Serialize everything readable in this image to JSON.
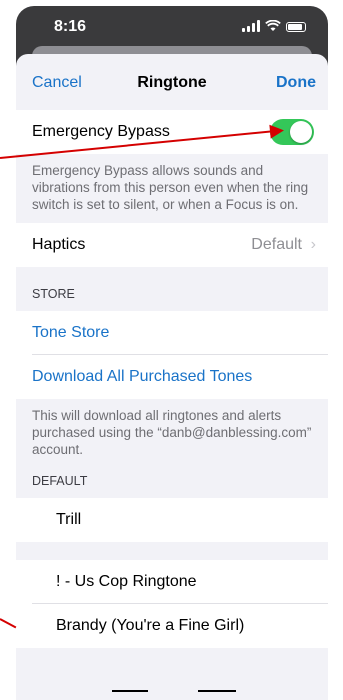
{
  "status": {
    "time": "8:16"
  },
  "nav": {
    "cancel": "Cancel",
    "title": "Ringtone",
    "done": "Done"
  },
  "emergency": {
    "label": "Emergency Bypass",
    "enabled": true,
    "footnote": "Emergency Bypass allows sounds and vibrations from this person even when the ring switch is set to silent, or when a Focus is on."
  },
  "haptics": {
    "label": "Haptics",
    "value": "Default"
  },
  "store": {
    "header": "STORE",
    "tone_store": "Tone Store",
    "download_all": "Download All Purchased Tones",
    "footnote": "This will download all ringtones and alerts purchased using the “danb@danblessing.com” account."
  },
  "default_section": {
    "header": "DEFAULT",
    "tones": [
      "Trill"
    ]
  },
  "ringtones": [
    "! - Us Cop Ringtone",
    "Brandy (You're a Fine Girl)"
  ],
  "colors": {
    "accent": "#1a73c8",
    "toggle_on": "#34c759",
    "annotation": "#d40000"
  }
}
